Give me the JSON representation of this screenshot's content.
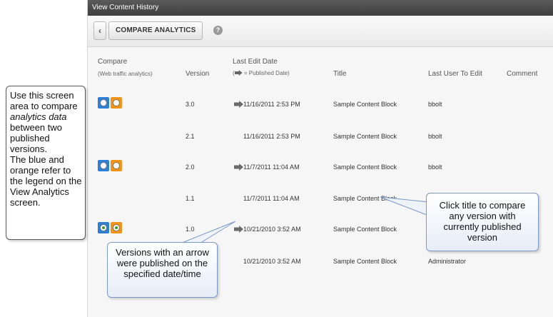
{
  "window": {
    "title": "View Content History"
  },
  "toolbar": {
    "back_label": "‹",
    "compare_label": "COMPARE ANALYTICS",
    "help_label": "?"
  },
  "columns": {
    "compare": "Compare",
    "compare_sub": "(Web traffic analytics)",
    "version": "Version",
    "last_edit": "Last Edit Date",
    "last_edit_sub": "= Published Date)",
    "last_edit_sub_prefix": "(",
    "title": "Title",
    "last_user": "Last User To Edit",
    "comment": "Comment"
  },
  "rows": [
    {
      "version": "3.0",
      "date": "11/16/2011 2:53 PM",
      "published": true,
      "title": "Sample Content Block",
      "user": "bbolt",
      "compare": true,
      "selected": false
    },
    {
      "version": "2.1",
      "date": "11/16/2011 2:53 PM",
      "published": false,
      "title": "Sample Content Block",
      "user": "bbolt",
      "compare": false,
      "selected": false
    },
    {
      "version": "2.0",
      "date": "11/7/2011 11:04 AM",
      "published": true,
      "title": "Sample Content Block",
      "user": "bbolt",
      "compare": true,
      "selected": false
    },
    {
      "version": "1.1",
      "date": "11/7/2011 11:04 AM",
      "published": false,
      "title": "Sample Content Block",
      "user": "",
      "compare": false,
      "selected": false
    },
    {
      "version": "1.0",
      "date": "10/21/2010 3:52 AM",
      "published": true,
      "title": "Sample Content Block",
      "user": "",
      "compare": true,
      "selected": true
    },
    {
      "version": "",
      "date": "10/21/2010 3:52 AM",
      "published": false,
      "title": "Sample Content Block",
      "user": "Administrator",
      "compare": false,
      "selected": false
    }
  ],
  "callouts": {
    "left_part1": "Use this screen area to compare ",
    "left_italic": "analytics data",
    "left_part2": " between two published versions.",
    "left_part3": "The blue and orange refer to the legend on the View Analytics screen.",
    "arrow_note": "Versions with an arrow were published on the specified date/time",
    "title_note": "Click title to compare any version with currently published version"
  },
  "colors": {
    "blue": "#2d7fd3",
    "orange": "#f29418",
    "callout_border": "#7d99c6"
  }
}
